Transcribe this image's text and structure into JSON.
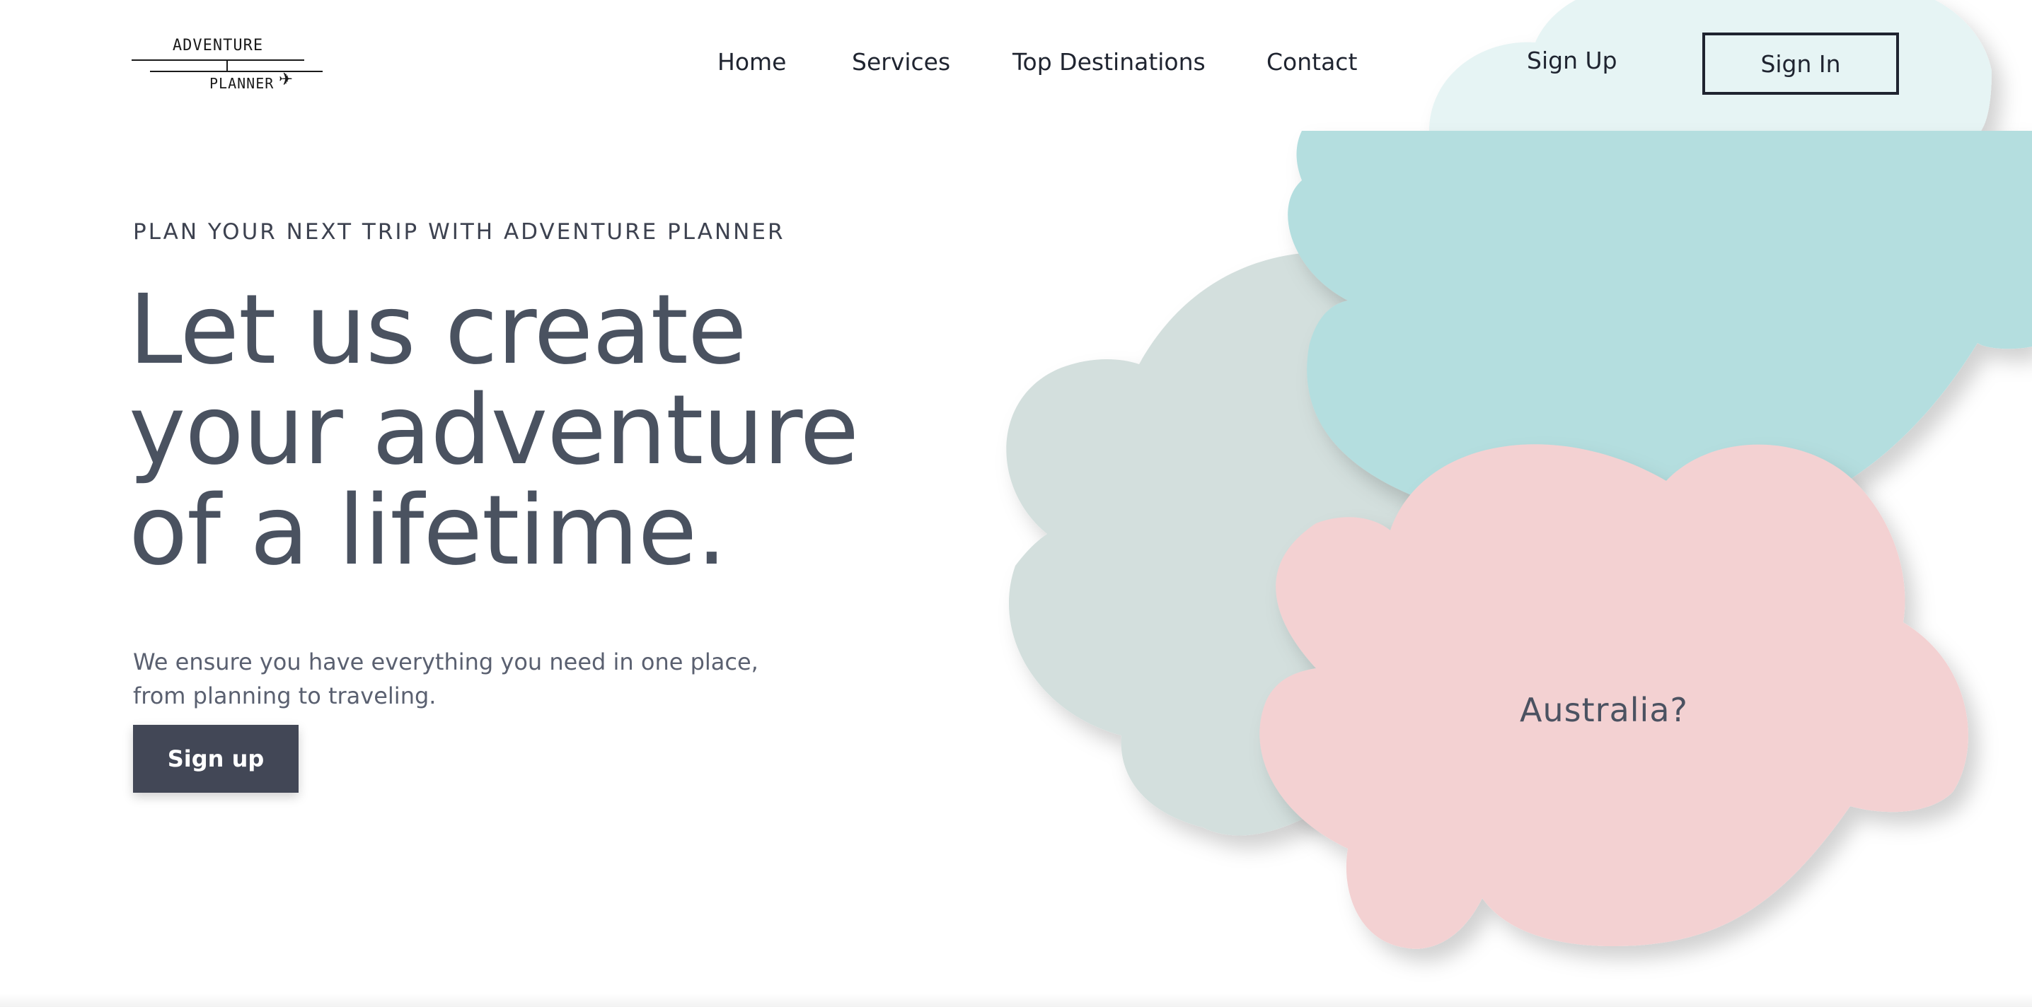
{
  "brand": {
    "logo_top": "ADVENTURE",
    "logo_bottom": "PLANNER",
    "plane_icon": "✈"
  },
  "nav": {
    "items": [
      {
        "label": "Home"
      },
      {
        "label": "Services"
      },
      {
        "label": "Top Destinations"
      },
      {
        "label": "Contact"
      }
    ],
    "sign_up": "Sign Up",
    "sign_in": "Sign In"
  },
  "hero": {
    "eyebrow": "PLAN YOUR NEXT TRIP WITH ADVENTURE PLANNER",
    "headline_lines": [
      "Let us create",
      "your adventure",
      "of a lifetime."
    ],
    "subtext_lines": [
      "We ensure you have everything you need in one place,",
      "from planning to traveling."
    ],
    "cta": "Sign up"
  },
  "clouds": {
    "destination_label": "Australia?",
    "colors": {
      "light_teal": "#e6f4f4",
      "teal": "#b4dedf",
      "gray": "#d3dfdd",
      "pink": "#f3d1d2"
    }
  },
  "colors": {
    "text_dark": "#1f2430",
    "headline": "#4a5260",
    "button_bg": "#424756",
    "button_text": "#ffffff"
  }
}
